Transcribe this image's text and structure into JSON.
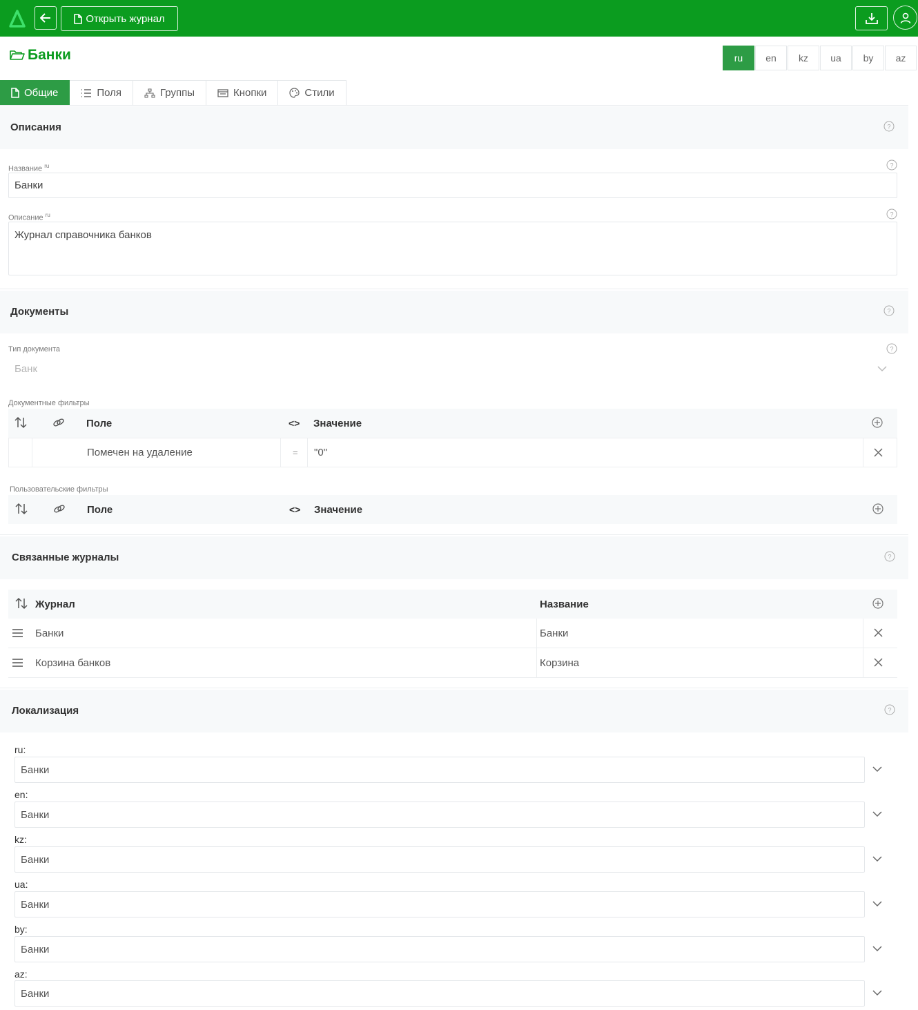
{
  "topbar": {
    "open_journal_label": "Открыть журнал",
    "logo_icon": "delta-logo-icon",
    "back_icon": "arrow-left-icon",
    "download_icon": "download-icon",
    "user_icon": "user-icon"
  },
  "page": {
    "title": "Банки"
  },
  "languages": [
    "ru",
    "en",
    "kz",
    "ua",
    "by",
    "az"
  ],
  "active_language": "ru",
  "tabs": [
    {
      "label": "Общие",
      "icon": "file-icon"
    },
    {
      "label": "Поля",
      "icon": "list-icon"
    },
    {
      "label": "Группы",
      "icon": "sitemap-icon"
    },
    {
      "label": "Кнопки",
      "icon": "window-icon"
    },
    {
      "label": "Стили",
      "icon": "palette-icon"
    }
  ],
  "descriptions": {
    "title": "Описания",
    "name_label": "Название",
    "name_lang_sup": "ru",
    "name_value": "Банки",
    "desc_label": "Описание",
    "desc_lang_sup": "ru",
    "desc_value": "Журнал справочника банков"
  },
  "documents": {
    "title": "Документы",
    "doc_type_label": "Тип документа",
    "doc_type_value": "Банк",
    "doc_filters_label": "Документные фильтры",
    "user_filters_label": "Пользовательские фильтры",
    "col_field": "Поле",
    "col_op_symbol": "<>",
    "col_value": "Значение",
    "doc_filter_rows": [
      {
        "field": "Помечен на удаление",
        "op": "=",
        "value": "\"0\""
      }
    ]
  },
  "related": {
    "title": "Связанные журналы",
    "col_journal": "Журнал",
    "col_name": "Название",
    "rows": [
      {
        "journal": "Банки",
        "name": "Банки"
      },
      {
        "journal": "Корзина банков",
        "name": "Корзина"
      }
    ]
  },
  "localization": {
    "title": "Локализация",
    "items": [
      {
        "lang": "ru:",
        "value": "Банки"
      },
      {
        "lang": "en:",
        "value": "Банки"
      },
      {
        "lang": "kz:",
        "value": "Банки"
      },
      {
        "lang": "ua:",
        "value": "Банки"
      },
      {
        "lang": "by:",
        "value": "Банки"
      },
      {
        "lang": "az:",
        "value": "Банки"
      }
    ]
  },
  "colors": {
    "brand_green": "#0b9c1f",
    "active_green": "#2d9c45"
  }
}
